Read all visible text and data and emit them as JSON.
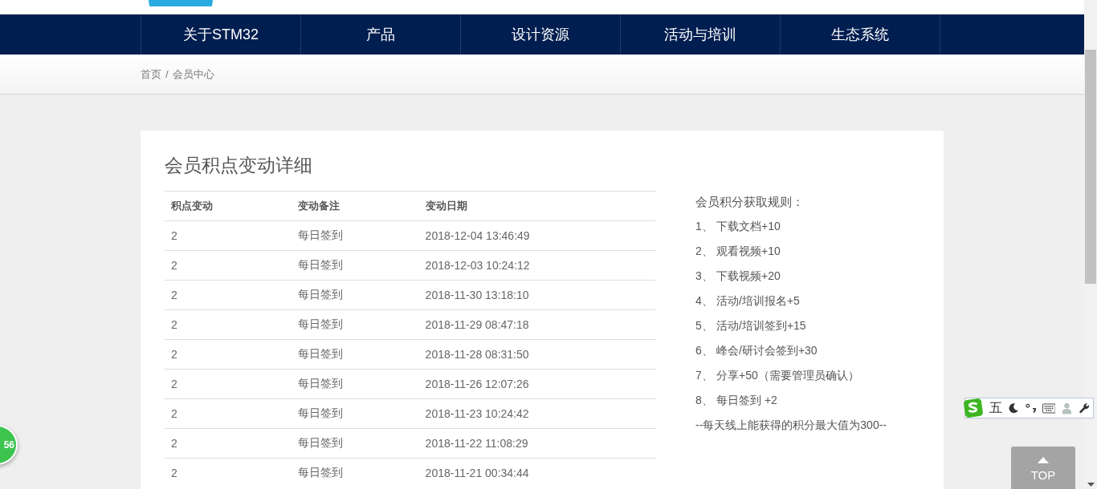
{
  "nav": {
    "items": [
      "关于STM32",
      "产品",
      "设计资源",
      "活动与培训",
      "生态系统"
    ]
  },
  "breadcrumb": {
    "items": [
      "首页",
      "会员中心"
    ],
    "separator": "/"
  },
  "panel": {
    "title": "会员积点变动详细",
    "table": {
      "columns": [
        "积点变动",
        "变动备注",
        "变动日期"
      ],
      "rows": [
        [
          "2",
          "每日签到",
          "2018-12-04 13:46:49"
        ],
        [
          "2",
          "每日签到",
          "2018-12-03 10:24:12"
        ],
        [
          "2",
          "每日签到",
          "2018-11-30 13:18:10"
        ],
        [
          "2",
          "每日签到",
          "2018-11-29 08:47:18"
        ],
        [
          "2",
          "每日签到",
          "2018-11-28 08:31:50"
        ],
        [
          "2",
          "每日签到",
          "2018-11-26 12:07:26"
        ],
        [
          "2",
          "每日签到",
          "2018-11-23 10:24:42"
        ],
        [
          "2",
          "每日签到",
          "2018-11-22 11:08:29"
        ],
        [
          "2",
          "每日签到",
          "2018-11-21 00:34:44"
        ]
      ]
    },
    "rules": {
      "title": "会员积分获取规则：",
      "items": [
        {
          "number": "1、",
          "text": "下载文档+10"
        },
        {
          "number": "2、",
          "text": "观看视频+10"
        },
        {
          "number": "3、",
          "text": "下载视频+20"
        },
        {
          "number": "4、",
          "text": "活动/培训报名+5"
        },
        {
          "number": "5、",
          "text": "活动/培训签到+15"
        },
        {
          "number": "6、",
          "text": "峰会/研讨会签到+30"
        },
        {
          "number": "7、",
          "text": "分享+50（需要管理员确认）"
        },
        {
          "number": "8、",
          "text": "每日签到 +2"
        }
      ],
      "note": "--每天线上能获得的积分最大值为300--"
    }
  },
  "float_badge": "56",
  "ime_toolbar": {
    "mode": "五"
  },
  "top_button": "TOP"
}
